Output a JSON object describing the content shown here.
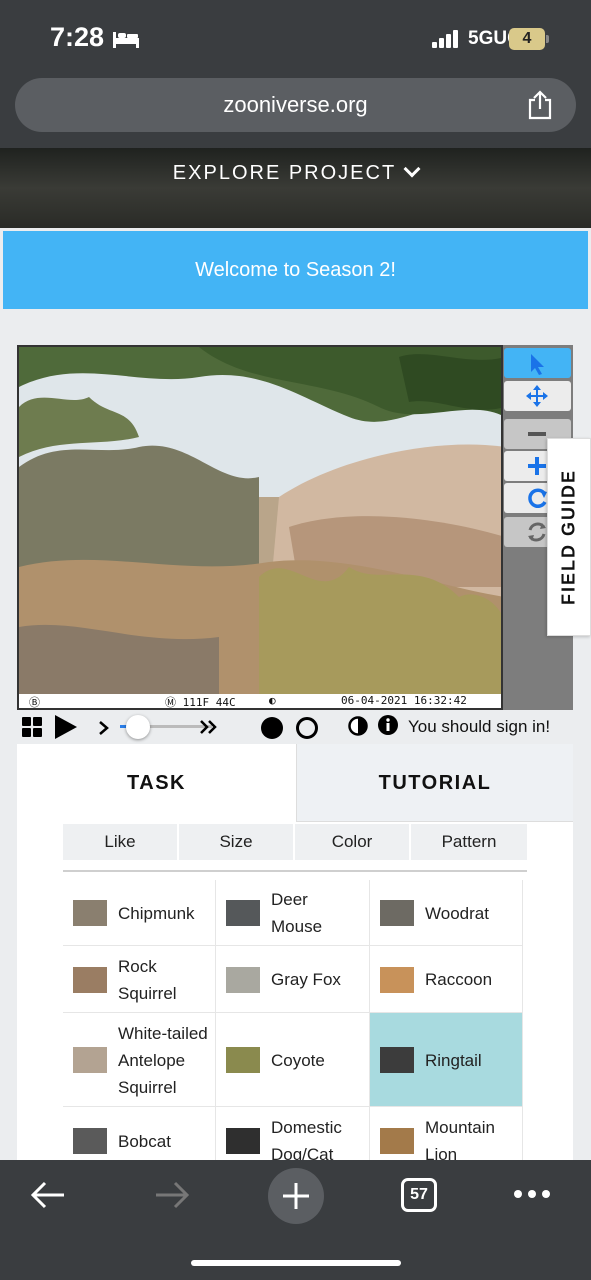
{
  "status_bar": {
    "time": "7:28",
    "network": "5GUC",
    "battery": "4"
  },
  "browser": {
    "url": "zooniverse.org",
    "tab_count": "57"
  },
  "site": {
    "explore_label": "EXPLORE PROJECT",
    "banner": "Welcome to Season 2!"
  },
  "viewer": {
    "stamp_mark": "Ⓑ",
    "stamp_temps": "Ⓜ 111F  44C",
    "stamp_datetime": "06-04-2021 16:32:42",
    "tools": [
      "pointer-icon",
      "move-icon",
      "zoom-out-icon",
      "zoom-in-icon",
      "rotate-icon",
      "reset-icon"
    ],
    "field_guide": "FIELD GUIDE"
  },
  "controls": {
    "signin_text": "You should sign in!",
    "playback_position": 0.2
  },
  "tabs": {
    "task": "TASK",
    "tutorial": "TUTORIAL"
  },
  "filters": [
    "Like",
    "Size",
    "Color",
    "Pattern"
  ],
  "species": [
    {
      "name": "Chipmunk",
      "lines": [
        "Chipmunk"
      ],
      "thumb": "#8a7f6f",
      "selected": false
    },
    {
      "name": "Deer Mouse",
      "lines": [
        "Deer",
        "Mouse"
      ],
      "thumb": "#55585a",
      "selected": false
    },
    {
      "name": "Woodrat",
      "lines": [
        "Woodrat"
      ],
      "thumb": "#6d6a63",
      "selected": false
    },
    {
      "name": "Rock Squirrel",
      "lines": [
        "Rock",
        "Squirrel"
      ],
      "thumb": "#9a7d63",
      "selected": false
    },
    {
      "name": "Gray Fox",
      "lines": [
        "Gray Fox"
      ],
      "thumb": "#a9a8a0",
      "selected": false
    },
    {
      "name": "Raccoon",
      "lines": [
        "Raccoon"
      ],
      "thumb": "#c8925a",
      "selected": false
    },
    {
      "name": "White-tailed Antelope Squirrel",
      "lines": [
        "White-tailed",
        "Antelope",
        "Squirrel"
      ],
      "thumb": "#b3a392",
      "selected": false
    },
    {
      "name": "Coyote",
      "lines": [
        "Coyote"
      ],
      "thumb": "#8a8a4e",
      "selected": false
    },
    {
      "name": "Ringtail",
      "lines": [
        "Ringtail"
      ],
      "thumb": "#3c3c3c",
      "selected": true
    },
    {
      "name": "Bobcat",
      "lines": [
        "Bobcat"
      ],
      "thumb": "#5a5a5a",
      "selected": false
    },
    {
      "name": "Domestic Dog/Cat",
      "lines": [
        "Domestic",
        "Dog/Cat"
      ],
      "thumb": "#2f2f2f",
      "selected": false
    },
    {
      "name": "Mountain Lion",
      "lines": [
        "Mountain",
        "Lion"
      ],
      "thumb": "#a37a4a",
      "selected": false
    }
  ],
  "colors": {
    "accent": "#43b4f5",
    "selected_cell": "#a8dadf",
    "chrome": "#3a3d40"
  }
}
